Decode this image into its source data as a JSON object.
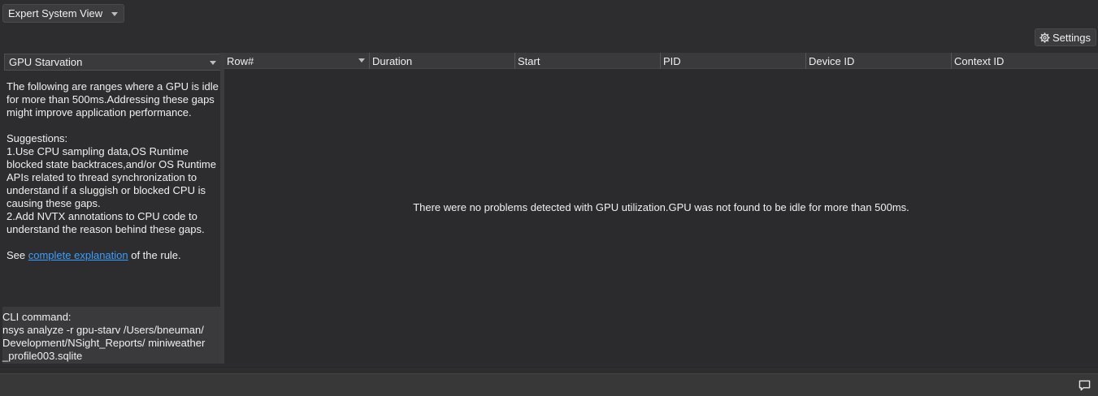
{
  "view_selector": {
    "label": "Expert System View"
  },
  "settings_button": {
    "label": "Settings"
  },
  "rule_selector": {
    "label": "GPU Starvation"
  },
  "description": {
    "intro": "The following are ranges where a GPU is idle for more than 500ms.Addressing these gaps might improve application performance.",
    "suggestions_heading": "Suggestions:",
    "suggestion_1": "1.Use CPU sampling data,OS Runtime blocked state backtraces,and/or OS Runtime APIs related to thread synchronization to understand if a sluggish or blocked CPU is causing these gaps.",
    "suggestion_2": "2.Add NVTX annotations to CPU code to understand the reason behind these gaps.",
    "see_prefix": "See ",
    "link_text": "complete explanation",
    "see_suffix": " of the rule."
  },
  "cli": {
    "label": "CLI command:",
    "command": "nsys analyze -r gpu-starv /Users/bneuman/ Development/NSight_Reports/ miniweather _profile003.sqlite"
  },
  "table": {
    "columns": [
      "Row#",
      "Duration",
      "Start",
      "PID",
      "Device ID",
      "Context ID"
    ],
    "empty_message": "There were no problems detected with GPU utilization.GPU was not found to be idle for more than 500ms."
  },
  "icons": {
    "settings": "gear-icon",
    "feedback": "chat-bubble-icon"
  }
}
